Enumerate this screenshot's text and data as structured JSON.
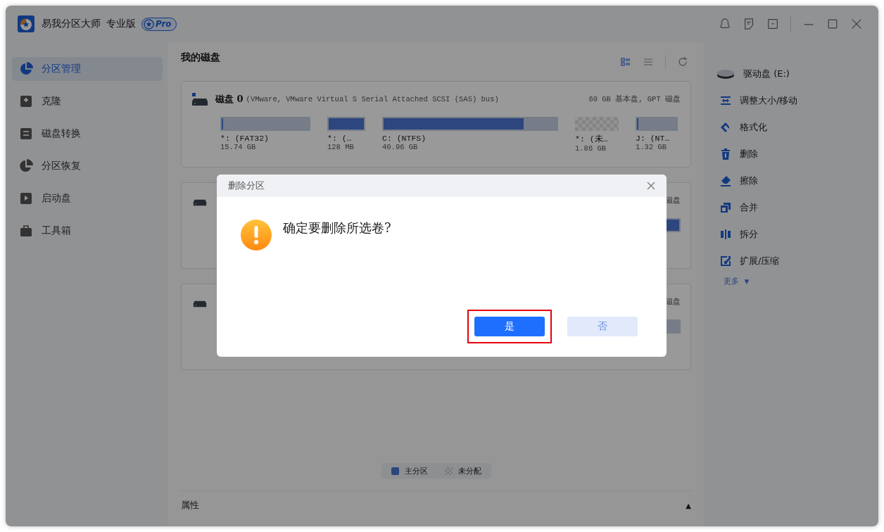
{
  "window": {
    "title": "易我分区大师",
    "edition": "专业版",
    "badge": "Pro"
  },
  "sidebar": {
    "items": [
      {
        "label": "分区管理",
        "selected": true,
        "kind": "pie"
      },
      {
        "label": "克隆",
        "selected": false,
        "kind": "clone"
      },
      {
        "label": "磁盘转换",
        "selected": false,
        "kind": "convert"
      },
      {
        "label": "分区恢复",
        "selected": false,
        "kind": "recover"
      },
      {
        "label": "启动盘",
        "selected": false,
        "kind": "boot"
      },
      {
        "label": "工具箱",
        "selected": false,
        "kind": "toolbox"
      }
    ]
  },
  "main": {
    "title": "我的磁盘",
    "disks": [
      {
        "name": "磁盘 0",
        "model": "(VMware,  VMware Virtual S Serial Attached SCSI (SAS) bus)",
        "info": "60 GB 基本盘, GPT 磁盘",
        "partitions": [
          {
            "label": "*: (FAT32)",
            "size": "15.74 GB",
            "kind": "primary",
            "level": 0.02
          },
          {
            "label": "*: (…",
            "size": "128 MB",
            "kind": "primary",
            "level": 1
          },
          {
            "label": "C: (NTFS)",
            "size": "40.96 GB",
            "kind": "primary",
            "level": 0.81
          },
          {
            "label": "*: (未…",
            "size": "1.86 GB",
            "kind": "unallocated"
          },
          {
            "label": "J: (NT…",
            "size": "1.32 GB",
            "kind": "primary",
            "level": 0.03
          }
        ]
      },
      {
        "info": "磁盘",
        "partitions": [
          {
            "kind": "primary",
            "level": 1
          }
        ]
      },
      {
        "info": "磁盘",
        "partitions": [
          {
            "kind": "primary",
            "level": 0
          }
        ]
      }
    ],
    "legend": [
      {
        "label": "主分区",
        "kind": "primary"
      },
      {
        "label": "未分配",
        "kind": "unallocated"
      }
    ],
    "properties": {
      "label": "属性",
      "toggle": "▲"
    }
  },
  "actions": {
    "drive": "驱动盘  (E:)",
    "items": [
      {
        "label": "调整大小/移动",
        "kind": "resize"
      },
      {
        "label": "格式化",
        "kind": "format"
      },
      {
        "label": "删除",
        "kind": "delete"
      },
      {
        "label": "擦除",
        "kind": "wipe"
      },
      {
        "label": "合并",
        "kind": "merge"
      },
      {
        "label": "拆分",
        "kind": "split"
      },
      {
        "label": "扩展/压缩",
        "kind": "extend"
      }
    ],
    "more": "更多",
    "more_caret": "▼"
  },
  "dialog": {
    "title": "删除分区",
    "message": "确定要删除所选卷?",
    "buttons": [
      {
        "label": "是",
        "kind": "primary",
        "highlighted": true
      },
      {
        "label": "否",
        "kind": "secondary",
        "highlighted": false
      }
    ]
  }
}
